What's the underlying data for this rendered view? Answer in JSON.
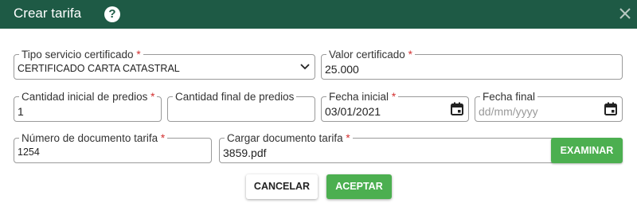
{
  "dialog": {
    "title": "Crear tarifa",
    "help_icon": "question-circle-icon",
    "close_icon": "close-icon"
  },
  "form": {
    "tipo_servicio": {
      "label": "Tipo servicio certificado",
      "required_mark": "*",
      "value": "CERTIFICADO CARTA CATASTRAL"
    },
    "valor_certificado": {
      "label": "Valor certificado",
      "required_mark": "*",
      "value": "25.000"
    },
    "cantidad_inicial": {
      "label": "Cantidad inicial de predios",
      "required_mark": "*",
      "value": "1"
    },
    "cantidad_final": {
      "label": "Cantidad final de predios",
      "value": ""
    },
    "fecha_inicial": {
      "label": "Fecha inicial",
      "required_mark": "*",
      "value": "03/01/2021"
    },
    "fecha_final": {
      "label": "Fecha final",
      "placeholder": "dd/mm/yyyy"
    },
    "numero_documento": {
      "label": "Número de documento tarifa",
      "required_mark": "*",
      "value": "1254"
    },
    "cargar_documento": {
      "label": "Cargar documento tarifa",
      "required_mark": "*",
      "value": "3859.pdf",
      "button_label": "EXAMINAR"
    }
  },
  "actions": {
    "cancel_label": "CANCELAR",
    "accept_label": "ACEPTAR"
  },
  "colors": {
    "header": "#1e5a45",
    "accent": "#4caf50",
    "required": "#d32f2f"
  }
}
